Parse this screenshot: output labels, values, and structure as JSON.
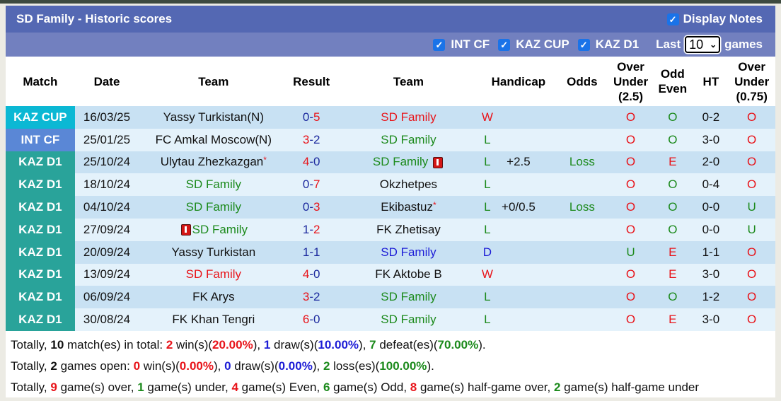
{
  "header": {
    "title": "SD Family - Historic scores",
    "display_notes_label": "Display Notes",
    "display_notes_checked": true
  },
  "filters": {
    "items": [
      {
        "label": "INT CF",
        "checked": true
      },
      {
        "label": "KAZ CUP",
        "checked": true
      },
      {
        "label": "KAZ D1",
        "checked": true
      }
    ],
    "last_label": "Last",
    "last_value": "10",
    "games_label": "games"
  },
  "columns": [
    "Match",
    "Date",
    "Team",
    "Result",
    "Team",
    "Handicap",
    "Odds",
    "Over Under (2.5)",
    "Odd Even",
    "HT",
    "Over Under (0.75)"
  ],
  "rows": [
    {
      "match": "KAZ CUP",
      "date": "16/03/25",
      "home": "Yassy Turkistan(N)",
      "home_style": "black",
      "home_star": false,
      "home_card": false,
      "score_h": "0",
      "score_a": "5",
      "score_h_color": "navy",
      "score_a_color": "red",
      "away": "SD Family",
      "away_style": "red",
      "away_star": false,
      "away_card": false,
      "wl": "W",
      "wl_color": "red",
      "handicap": "",
      "odds": "",
      "ou": "O",
      "ou_color": "red",
      "oe": "O",
      "oe_color": "green",
      "ht": "0-2",
      "ou2": "O",
      "ou2_color": "red"
    },
    {
      "match": "INT CF",
      "date": "25/01/25",
      "home": "FC Amkal Moscow(N)",
      "home_style": "black",
      "home_star": false,
      "home_card": false,
      "score_h": "3",
      "score_a": "2",
      "score_h_color": "red",
      "score_a_color": "navy",
      "away": "SD Family",
      "away_style": "green",
      "away_star": false,
      "away_card": false,
      "wl": "L",
      "wl_color": "green",
      "handicap": "",
      "odds": "",
      "ou": "O",
      "ou_color": "red",
      "oe": "O",
      "oe_color": "green",
      "ht": "3-0",
      "ou2": "O",
      "ou2_color": "red"
    },
    {
      "match": "KAZ D1",
      "date": "25/10/24",
      "home": "Ulytau Zhezkazgan",
      "home_style": "black",
      "home_star": true,
      "home_card": false,
      "score_h": "4",
      "score_a": "0",
      "score_h_color": "red",
      "score_a_color": "navy",
      "away": "SD Family",
      "away_style": "green",
      "away_star": false,
      "away_card": true,
      "wl": "L",
      "wl_color": "green",
      "handicap": "+2.5",
      "odds": "Loss",
      "ou": "O",
      "ou_color": "red",
      "oe": "E",
      "oe_color": "red",
      "ht": "2-0",
      "ou2": "O",
      "ou2_color": "red"
    },
    {
      "match": "KAZ D1",
      "date": "18/10/24",
      "home": "SD Family",
      "home_style": "green",
      "home_star": false,
      "home_card": false,
      "score_h": "0",
      "score_a": "7",
      "score_h_color": "navy",
      "score_a_color": "red",
      "away": "Okzhetpes",
      "away_style": "black",
      "away_star": false,
      "away_card": false,
      "wl": "L",
      "wl_color": "green",
      "handicap": "",
      "odds": "",
      "ou": "O",
      "ou_color": "red",
      "oe": "O",
      "oe_color": "green",
      "ht": "0-4",
      "ou2": "O",
      "ou2_color": "red"
    },
    {
      "match": "KAZ D1",
      "date": "04/10/24",
      "home": "SD Family",
      "home_style": "green",
      "home_star": false,
      "home_card": false,
      "score_h": "0",
      "score_a": "3",
      "score_h_color": "navy",
      "score_a_color": "red",
      "away": "Ekibastuz",
      "away_style": "black",
      "away_star": true,
      "away_card": false,
      "wl": "L",
      "wl_color": "green",
      "handicap": "+0/0.5",
      "odds": "Loss",
      "ou": "O",
      "ou_color": "red",
      "oe": "O",
      "oe_color": "green",
      "ht": "0-0",
      "ou2": "U",
      "ou2_color": "green"
    },
    {
      "match": "KAZ D1",
      "date": "27/09/24",
      "home": "SD Family",
      "home_style": "green",
      "home_star": false,
      "home_card": true,
      "score_h": "1",
      "score_a": "2",
      "score_h_color": "navy",
      "score_a_color": "red",
      "away": "FK Zhetisay",
      "away_style": "black",
      "away_star": false,
      "away_card": false,
      "wl": "L",
      "wl_color": "green",
      "handicap": "",
      "odds": "",
      "ou": "O",
      "ou_color": "red",
      "oe": "O",
      "oe_color": "green",
      "ht": "0-0",
      "ou2": "U",
      "ou2_color": "green"
    },
    {
      "match": "KAZ D1",
      "date": "20/09/24",
      "home": "Yassy Turkistan",
      "home_style": "black",
      "home_star": false,
      "home_card": false,
      "score_h": "1",
      "score_a": "1",
      "score_h_color": "navy",
      "score_a_color": "navy",
      "away": "SD Family",
      "away_style": "blue",
      "away_star": false,
      "away_card": false,
      "wl": "D",
      "wl_color": "blue",
      "handicap": "",
      "odds": "",
      "ou": "U",
      "ou_color": "green",
      "oe": "E",
      "oe_color": "red",
      "ht": "1-1",
      "ou2": "O",
      "ou2_color": "red"
    },
    {
      "match": "KAZ D1",
      "date": "13/09/24",
      "home": "SD Family",
      "home_style": "red",
      "home_star": false,
      "home_card": false,
      "score_h": "4",
      "score_a": "0",
      "score_h_color": "red",
      "score_a_color": "navy",
      "away": "FK Aktobe B",
      "away_style": "black",
      "away_star": false,
      "away_card": false,
      "wl": "W",
      "wl_color": "red",
      "handicap": "",
      "odds": "",
      "ou": "O",
      "ou_color": "red",
      "oe": "E",
      "oe_color": "red",
      "ht": "3-0",
      "ou2": "O",
      "ou2_color": "red"
    },
    {
      "match": "KAZ D1",
      "date": "06/09/24",
      "home": "FK Arys",
      "home_style": "black",
      "home_star": false,
      "home_card": false,
      "score_h": "3",
      "score_a": "2",
      "score_h_color": "red",
      "score_a_color": "navy",
      "away": "SD Family",
      "away_style": "green",
      "away_star": false,
      "away_card": false,
      "wl": "L",
      "wl_color": "green",
      "handicap": "",
      "odds": "",
      "ou": "O",
      "ou_color": "red",
      "oe": "O",
      "oe_color": "green",
      "ht": "1-2",
      "ou2": "O",
      "ou2_color": "red"
    },
    {
      "match": "KAZ D1",
      "date": "30/08/24",
      "home": "FK Khan Tengri",
      "home_style": "black",
      "home_star": false,
      "home_card": false,
      "score_h": "6",
      "score_a": "0",
      "score_h_color": "red",
      "score_a_color": "navy",
      "away": "SD Family",
      "away_style": "green",
      "away_star": false,
      "away_card": false,
      "wl": "L",
      "wl_color": "green",
      "handicap": "",
      "odds": "",
      "ou": "O",
      "ou_color": "red",
      "oe": "E",
      "oe_color": "red",
      "ht": "3-0",
      "ou2": "O",
      "ou2_color": "red"
    }
  ],
  "summary": [
    [
      {
        "t": "Totally, "
      },
      {
        "t": "10",
        "c": "b"
      },
      {
        "t": " match(es) in total: "
      },
      {
        "t": "2",
        "c": "red"
      },
      {
        "t": " win(s)("
      },
      {
        "t": "20.00%",
        "c": "red"
      },
      {
        "t": "), "
      },
      {
        "t": "1",
        "c": "blue"
      },
      {
        "t": " draw(s)("
      },
      {
        "t": "10.00%",
        "c": "blue"
      },
      {
        "t": "), "
      },
      {
        "t": "7",
        "c": "green"
      },
      {
        "t": " defeat(es)("
      },
      {
        "t": "70.00%",
        "c": "green"
      },
      {
        "t": ")."
      }
    ],
    [
      {
        "t": "Totally, "
      },
      {
        "t": "2",
        "c": "b"
      },
      {
        "t": " games open: "
      },
      {
        "t": "0",
        "c": "red"
      },
      {
        "t": " win(s)("
      },
      {
        "t": "0.00%",
        "c": "red"
      },
      {
        "t": "), "
      },
      {
        "t": "0",
        "c": "blue"
      },
      {
        "t": " draw(s)("
      },
      {
        "t": "0.00%",
        "c": "blue"
      },
      {
        "t": "), "
      },
      {
        "t": "2",
        "c": "green"
      },
      {
        "t": " loss(es)("
      },
      {
        "t": "100.00%",
        "c": "green"
      },
      {
        "t": ")."
      }
    ],
    [
      {
        "t": "Totally, "
      },
      {
        "t": "9",
        "c": "red"
      },
      {
        "t": " game(s) over, "
      },
      {
        "t": "1",
        "c": "green"
      },
      {
        "t": " game(s) under, "
      },
      {
        "t": "4",
        "c": "red"
      },
      {
        "t": " game(s) Even, "
      },
      {
        "t": "6",
        "c": "green"
      },
      {
        "t": " game(s) Odd, "
      },
      {
        "t": "8",
        "c": "red"
      },
      {
        "t": " game(s) half-game over, "
      },
      {
        "t": "2",
        "c": "green"
      },
      {
        "t": " game(s) half-game under"
      }
    ]
  ],
  "colors": {
    "title_bar": "#5468b3",
    "filter_bar": "#7280bf",
    "kaz_cup": "#0bb8d4",
    "int_cf": "#5a87d6",
    "kaz_d1": "#29a39a",
    "row_odd": "#c8e1f3",
    "row_even": "#e4f2fb",
    "red": "#e8141a",
    "green": "#1c8a1c",
    "blue": "#1d1dd6"
  }
}
